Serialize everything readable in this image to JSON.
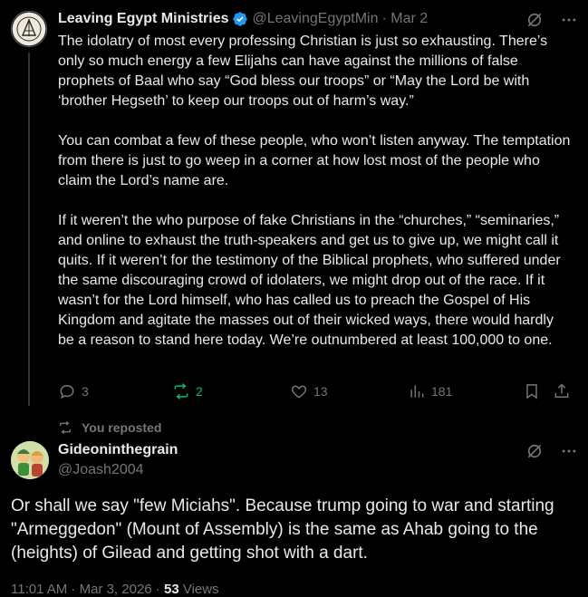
{
  "colors": {
    "background": "#000000",
    "text": "#e7e9ea",
    "muted": "#71767b",
    "verified": "#1d9bf0",
    "repost_green": "#00ba7c"
  },
  "tweet1": {
    "author_name": "Leaving Egypt Ministries",
    "handle": "@LeavingEgyptMin",
    "date": "· Mar 2",
    "paragraphs": [
      "The idolatry of most every professing Christian is just so exhausting. There’s only so much energy a few Elijahs can have against the millions of false prophets of Baal who say “God bless our troops” or “May the Lord be with ‘brother Hegseth’ to keep our troops out of harm’s way.”",
      "You can combat a few of these people, who won’t listen anyway. The temptation from there is just to go weep in a corner at how lost most of the people who claim the Lord’s name are.",
      "If it weren’t the who purpose of fake Christians in the “churches,” “seminaries,” and online to exhaust the truth-speakers and get us to give up, we might call it quits. If it weren’t for the testimony of the Biblical prophets, who suffered under the same discouraging crowd of idolaters, we might drop out of the race. If it wasn’t for the Lord himself, who has called us to preach the Gospel of His Kingdom and agitate the masses out of their wicked ways, there would hardly be a reason to stand here today. We’re outnumbered at least 100,000 to one."
    ],
    "replies": "3",
    "reposts": "2",
    "likes": "13",
    "views": "181",
    "icons": [
      "grok-icon",
      "more-icon",
      "reply-icon",
      "repost-icon",
      "like-icon",
      "views-icon",
      "bookmark-icon",
      "share-icon",
      "verified-badge-icon"
    ]
  },
  "repost_banner": {
    "text": "You reposted"
  },
  "tweet2": {
    "author_name": "Gideoninthegrain",
    "handle": "@Joash2004",
    "text": "Or shall we say \"few Miciahs\". Because trump going to war and starting \"Armeggedon\" (Mount of Assembly) is the same as Ahab going to the (heights) of Gilead and getting shot with a dart.",
    "timestamp": "11:01 AM · Mar 3, 2026 · ",
    "views_count": "53",
    "views_label": " Views"
  }
}
